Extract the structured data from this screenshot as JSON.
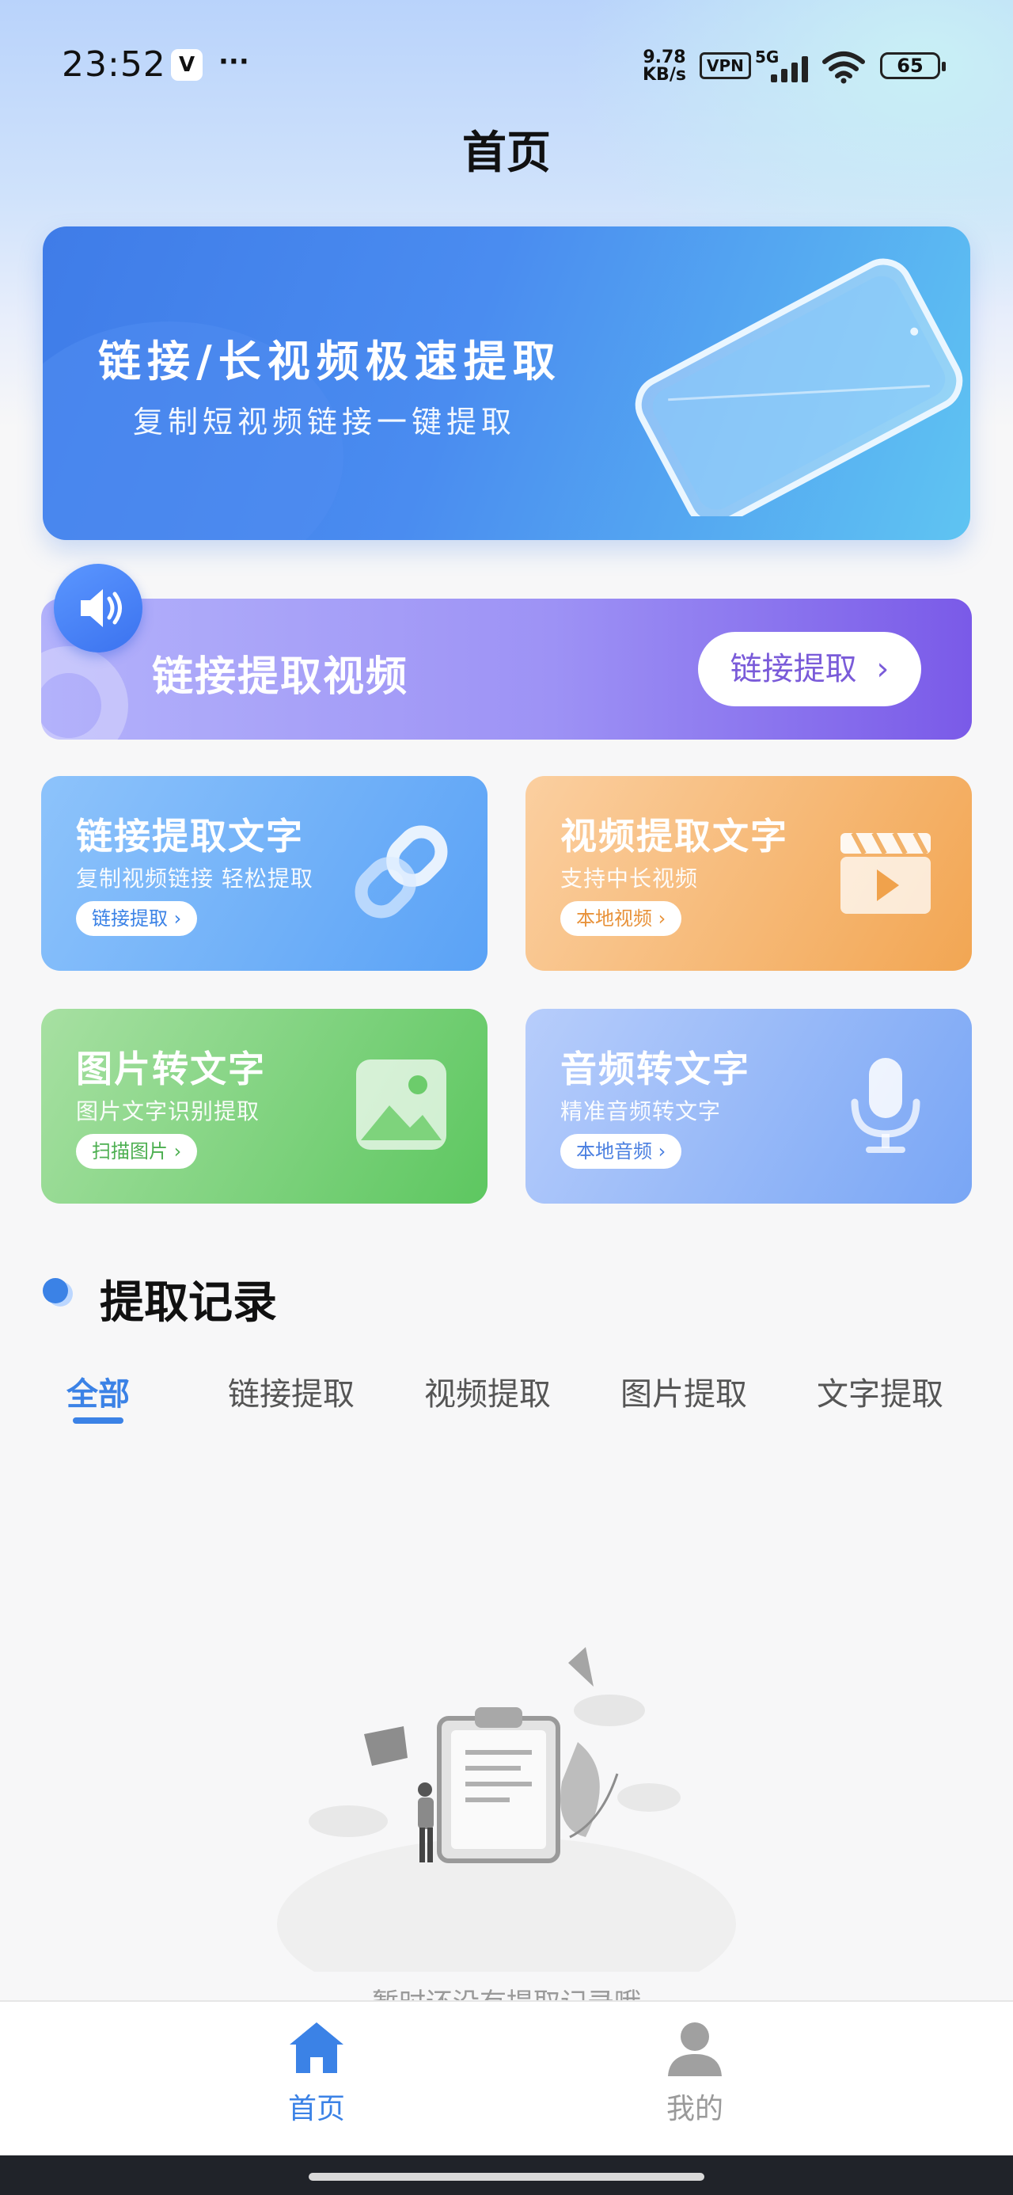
{
  "status_bar": {
    "time": "23:52",
    "app_badge": "V",
    "more": "···",
    "speed_value": "9.78",
    "speed_unit": "KB/s",
    "vpn": "VPN",
    "network": "5G",
    "battery": "65"
  },
  "header": {
    "title": "首页"
  },
  "banner": {
    "title": "链接/长视频极速提取",
    "subtitle": "复制短视频链接一键提取"
  },
  "link_video_card": {
    "title": "链接提取视频",
    "button_label": "链接提取",
    "button_chevron": "›"
  },
  "features": [
    {
      "title": "链接提取文字",
      "subtitle": "复制视频链接 轻松提取",
      "button_label": "链接提取",
      "icon": "link-icon"
    },
    {
      "title": "视频提取文字",
      "subtitle": "支持中长视频",
      "button_label": "本地视频",
      "icon": "clapperboard-icon"
    },
    {
      "title": "图片转文字",
      "subtitle": "图片文字识别提取",
      "button_label": "扫描图片",
      "icon": "image-icon"
    },
    {
      "title": "音频转文字",
      "subtitle": "精准音频转文字",
      "button_label": "本地音频",
      "icon": "microphone-icon"
    }
  ],
  "records": {
    "title": "提取记录",
    "tabs": [
      "全部",
      "链接提取",
      "视频提取",
      "图片提取",
      "文字提取"
    ],
    "active_tab": "全部",
    "empty_text": "暂时还没有提取记录哦"
  },
  "tab_bar": {
    "items": [
      {
        "label": "首页",
        "icon": "home-icon",
        "active": true
      },
      {
        "label": "我的",
        "icon": "user-icon",
        "active": false
      }
    ]
  },
  "colors": {
    "accent": "#3b82e6",
    "purple": "#7a5ae8",
    "orange": "#f2a653",
    "green": "#5dc760"
  }
}
